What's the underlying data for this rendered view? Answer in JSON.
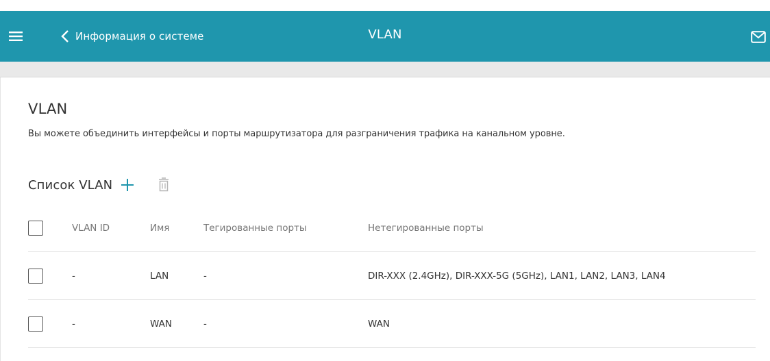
{
  "header": {
    "back_label": "Информация о системе",
    "title": "VLAN",
    "icons": {
      "menu": "hamburger-menu-icon",
      "back": "chevron-left-icon",
      "mail": "envelope-icon"
    },
    "background_color": "#1f96ad"
  },
  "section": {
    "title": "VLAN",
    "description": "Вы можете объединить интерфейсы и порты маршрутизатора для разграничения трафика на канальном уровне."
  },
  "vlan_list": {
    "title": "Список VLAN",
    "add_icon": "plus-icon",
    "delete_icon": "trash-icon",
    "accent_color": "#1f96ad",
    "columns": [
      "VLAN ID",
      "Имя",
      "Тегированные порты",
      "Нетегированные порты"
    ],
    "rows": [
      {
        "vlan_id": "-",
        "name": "LAN",
        "tagged": "-",
        "untagged": "DIR-XXX (2.4GHz), DIR-XXX-5G (5GHz), LAN1, LAN2, LAN3, LAN4"
      },
      {
        "vlan_id": "-",
        "name": "WAN",
        "tagged": "-",
        "untagged": "WAN"
      }
    ]
  }
}
